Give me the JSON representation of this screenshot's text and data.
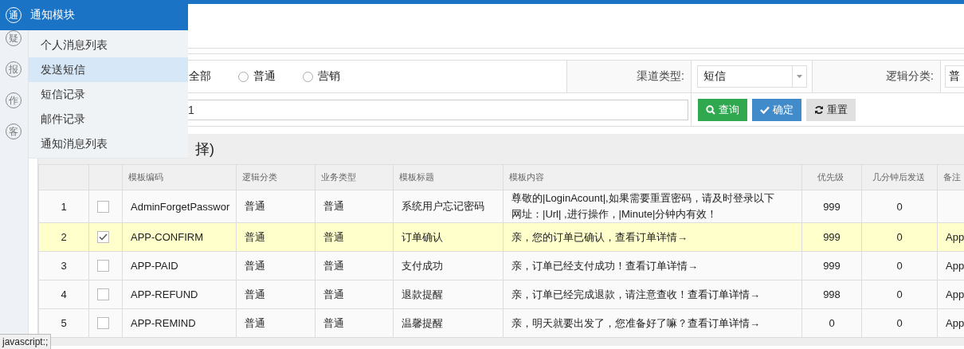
{
  "module": {
    "icon": "通",
    "title": "通知模块"
  },
  "sidebar": {
    "icons": [
      "疑",
      "报",
      "作",
      "客"
    ]
  },
  "menu": {
    "items": [
      {
        "label": "个人消息列表",
        "selected": false
      },
      {
        "label": "发送短信",
        "selected": true
      },
      {
        "label": "短信记录",
        "selected": false
      },
      {
        "label": "邮件记录",
        "selected": false
      },
      {
        "label": "通知消息列表",
        "selected": false
      }
    ]
  },
  "filter": {
    "type_options": [
      {
        "label": "全部"
      },
      {
        "label": "普通",
        "selected": false
      },
      {
        "label": "营销",
        "selected": false
      }
    ],
    "channel_label": "渠道类型:",
    "channel_value": "短信",
    "logic_label": "逻辑分类:",
    "logic_value": "普",
    "keyword_value": "1",
    "buttons": [
      {
        "kind": "search",
        "label": "查询"
      },
      {
        "kind": "confirm",
        "label": "确定"
      },
      {
        "kind": "reset",
        "label": "重置"
      }
    ]
  },
  "panel": {
    "title": "择)"
  },
  "table": {
    "columns": [
      "模板编码",
      "逻辑分类",
      "业务类型",
      "模板标题",
      "模板内容",
      "优先级",
      "几分钟后发送",
      "备注"
    ],
    "rows": [
      {
        "index": "1",
        "checked": false,
        "selected": false,
        "code": "AdminForgetPasswor",
        "logic": "普通",
        "business": "普通",
        "title": "系统用户忘记密码",
        "content": "尊敬的|LoginAcount|,如果需要重置密码，请及时登录以下网址：|Url| ,进行操作，|Minute|分钟内有效！",
        "priority": "999",
        "delay": "0"
      },
      {
        "index": "2",
        "checked": true,
        "selected": true,
        "code": "APP-CONFIRM",
        "logic": "普通",
        "business": "普通",
        "title": "订单确认",
        "content": "亲，您的订单已确认，查看订单详情→",
        "priority": "999",
        "delay": "0",
        "remark": "App"
      },
      {
        "index": "3",
        "checked": false,
        "selected": false,
        "code": "APP-PAID",
        "logic": "普通",
        "business": "普通",
        "title": "支付成功",
        "content": "亲，订单已经支付成功！查看订单详情→",
        "priority": "999",
        "delay": "0",
        "remark": "App"
      },
      {
        "index": "4",
        "checked": false,
        "selected": false,
        "code": "APP-REFUND",
        "logic": "普通",
        "business": "普通",
        "title": "退款提醒",
        "content": "亲，订单已经完成退款，请注意查收！查看订单详情→",
        "priority": "998",
        "delay": "0",
        "remark": "App"
      },
      {
        "index": "5",
        "checked": false,
        "selected": false,
        "code": "APP-REMIND",
        "logic": "普通",
        "business": "普通",
        "title": "温馨提醒",
        "content": "亲，明天就要出发了，您准备好了嘛？查看订单详情→",
        "priority": "0",
        "delay": "0",
        "remark": "App"
      }
    ]
  },
  "status_bar": {
    "text": "javascript:;"
  }
}
